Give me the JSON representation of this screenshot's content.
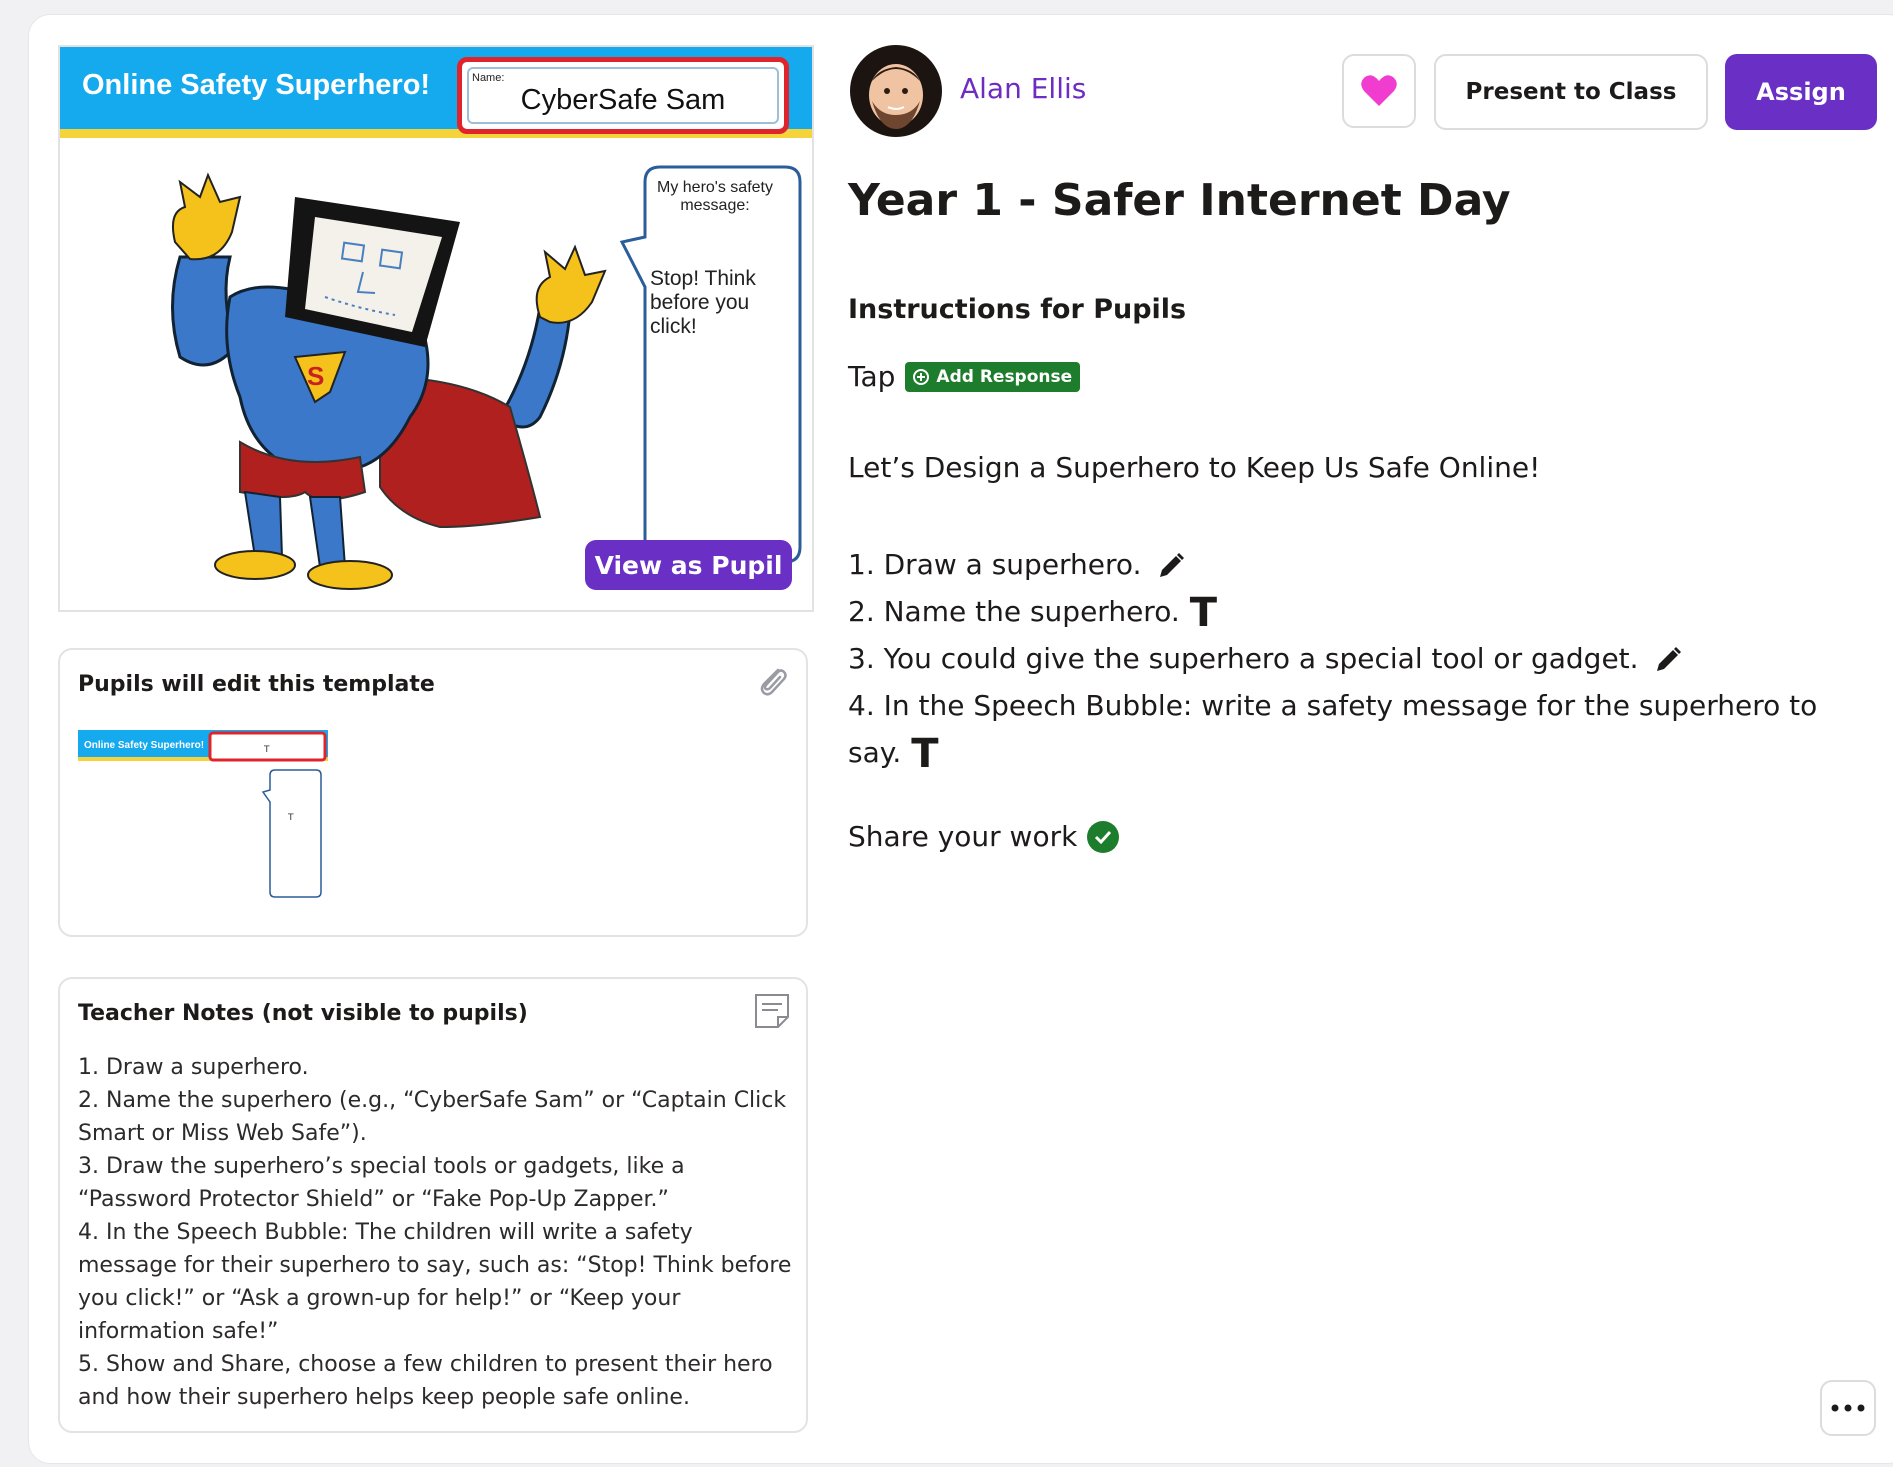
{
  "preview": {
    "banner_title": "Online Safety Superhero!",
    "name_label": "Name:",
    "name_value": "CyberSafe Sam",
    "bubble_label": "My hero's safety message:",
    "bubble_text": "Stop! Think before you click!",
    "view_as_pupil": "View as Pupil"
  },
  "template_panel": {
    "title": "Pupils will edit this template",
    "icon": "paperclip-icon",
    "thumb_banner": "Online Safety Superhero!"
  },
  "teacher_notes": {
    "title": "Teacher Notes (not visible to pupils)",
    "icon": "note-icon",
    "lines": [
      "1. Draw a superhero.",
      "2. Name the superhero (e.g., “CyberSafe Sam” or “Captain Click Smart or Miss Web Safe”).",
      "3. Draw the superhero’s special tools or gadgets, like a “Password Protector Shield” or “Fake Pop-Up Zapper.”",
      "4. In the Speech Bubble: The children will write a safety message for their superhero to say, such as: “Stop! Think before you click!” or “Ask a grown-up for help!” or “Keep your information safe!”",
      "5. Show and Share, choose a few children to present their hero and how their superhero helps keep people safe online."
    ]
  },
  "header": {
    "author": "Alan Ellis",
    "favorite_icon": "heart-icon",
    "present_label": "Present to Class",
    "assign_label": "Assign"
  },
  "lesson": {
    "title": "Year 1 - Safer Internet Day",
    "instructions_heading": "Instructions for Pupils",
    "tap_label": "Tap",
    "add_response_label": "Add Response",
    "intro": "Let’s Design a Superhero to Keep Us Safe Online!",
    "steps": [
      {
        "text": "1. Draw a superhero.",
        "icon": "pencil-icon"
      },
      {
        "text": "2. Name the superhero.",
        "icon": "text-icon"
      },
      {
        "text": "3. You could give the superhero a special tool or gadget.",
        "icon": "pencil-icon"
      },
      {
        "text": "4. In the Speech Bubble: write a safety message for the superhero to say.",
        "icon": "text-icon"
      }
    ],
    "share_label": "Share your work",
    "share_icon": "check-icon"
  },
  "more_icon": "more-icon",
  "colors": {
    "accent_purple": "#6a2fc4",
    "author_purple": "#6d2cc2",
    "heart_pink": "#f03ccf",
    "success_green": "#1e7d2d",
    "banner_blue": "#15a9ee",
    "banner_yellow": "#f5d33b"
  }
}
